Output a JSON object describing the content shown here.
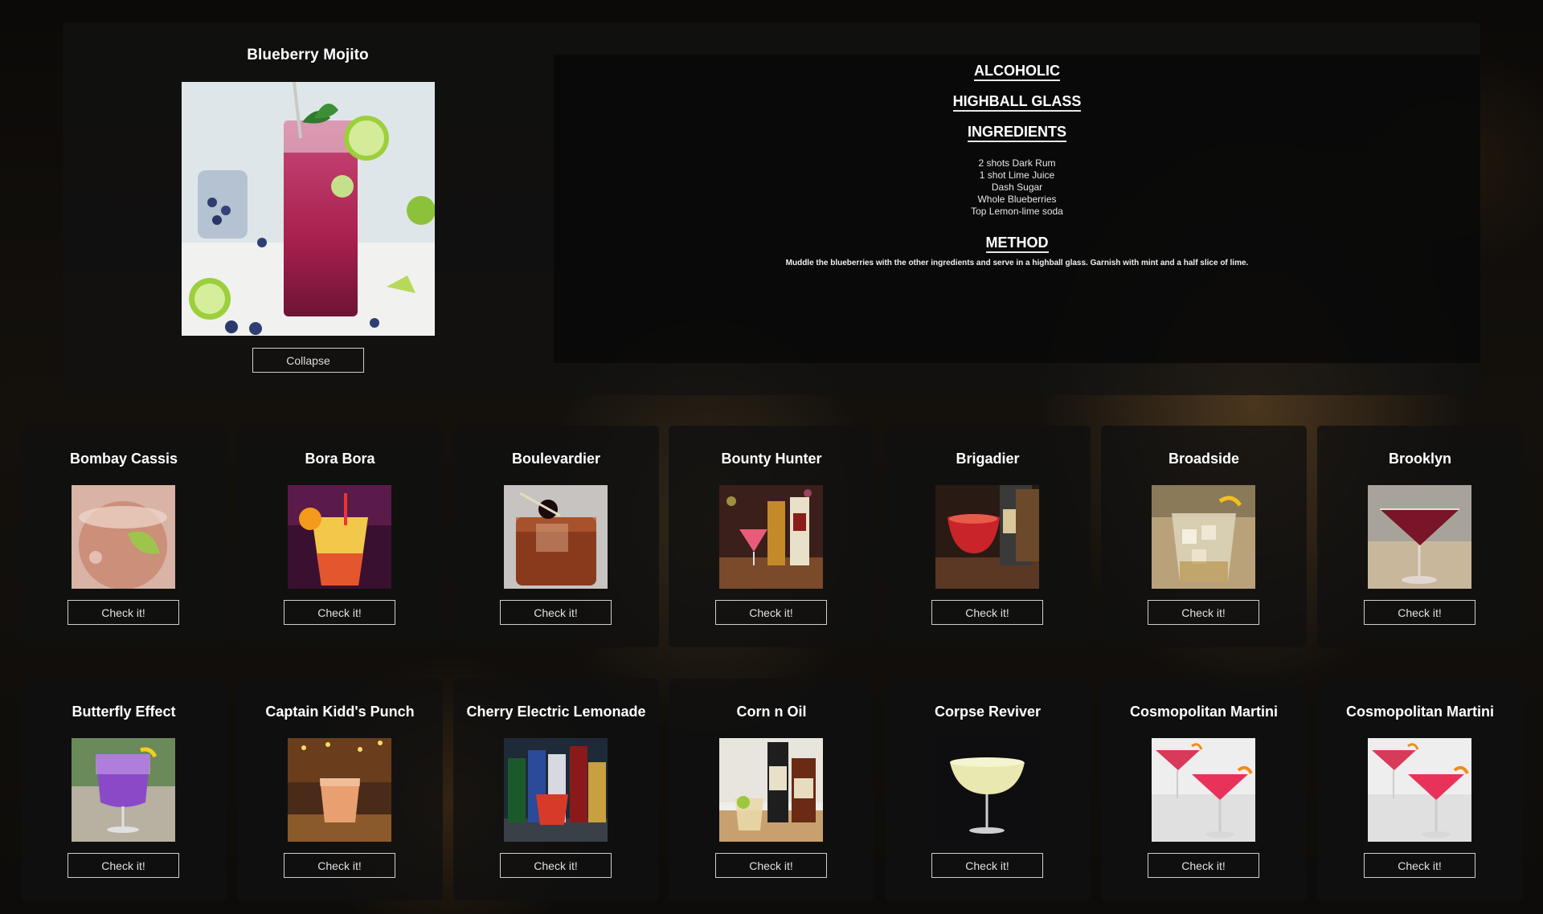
{
  "detail": {
    "title": "Blueberry Mojito",
    "collapse_label": "Collapse",
    "category": "ALCOHOLIC",
    "glass": "HIGHBALL GLASS",
    "ingredients_heading": "INGREDIENTS",
    "ingredients": [
      "2 shots Dark Rum",
      "1 shot Lime Juice",
      "Dash Sugar",
      "Whole Blueberries",
      "Top Lemon-lime soda"
    ],
    "method_heading": "METHOD",
    "method": "Muddle the blueberries with the other ingredients and serve in a highball glass. Garnish with mint and a half slice of lime."
  },
  "cards": [
    {
      "name": "Bombay Cassis",
      "button": "Check it!",
      "photo": "rose-cocktail-lime"
    },
    {
      "name": "Bora Bora",
      "button": "Check it!",
      "photo": "sunset-cocktail"
    },
    {
      "name": "Boulevardier",
      "button": "Check it!",
      "photo": "rocks-glass-cherry"
    },
    {
      "name": "Bounty Hunter",
      "button": "Check it!",
      "photo": "bar-bottles-pink-drink"
    },
    {
      "name": "Brigadier",
      "button": "Check it!",
      "photo": "red-cocktail-bottles"
    },
    {
      "name": "Broadside",
      "button": "Check it!",
      "photo": "ice-glass-lemon"
    },
    {
      "name": "Brooklyn",
      "button": "Check it!",
      "photo": "martini-red"
    },
    {
      "name": "Butterfly Effect",
      "button": "Check it!",
      "photo": "purple-goblet"
    },
    {
      "name": "Captain Kidd's Punch",
      "button": "Check it!",
      "photo": "bar-punch"
    },
    {
      "name": "Cherry Electric Lemonade",
      "button": "Check it!",
      "photo": "bottles-red-drink"
    },
    {
      "name": "Corn n Oil",
      "button": "Check it!",
      "photo": "rum-bottles-lime"
    },
    {
      "name": "Corpse Reviver",
      "button": "Check it!",
      "photo": "coupe-pale"
    },
    {
      "name": "Cosmopolitan Martini",
      "button": "Check it!",
      "photo": "two-cosmos"
    },
    {
      "name": "Cosmopolitan Martini",
      "button": "Check it!",
      "photo": "two-cosmos"
    }
  ]
}
